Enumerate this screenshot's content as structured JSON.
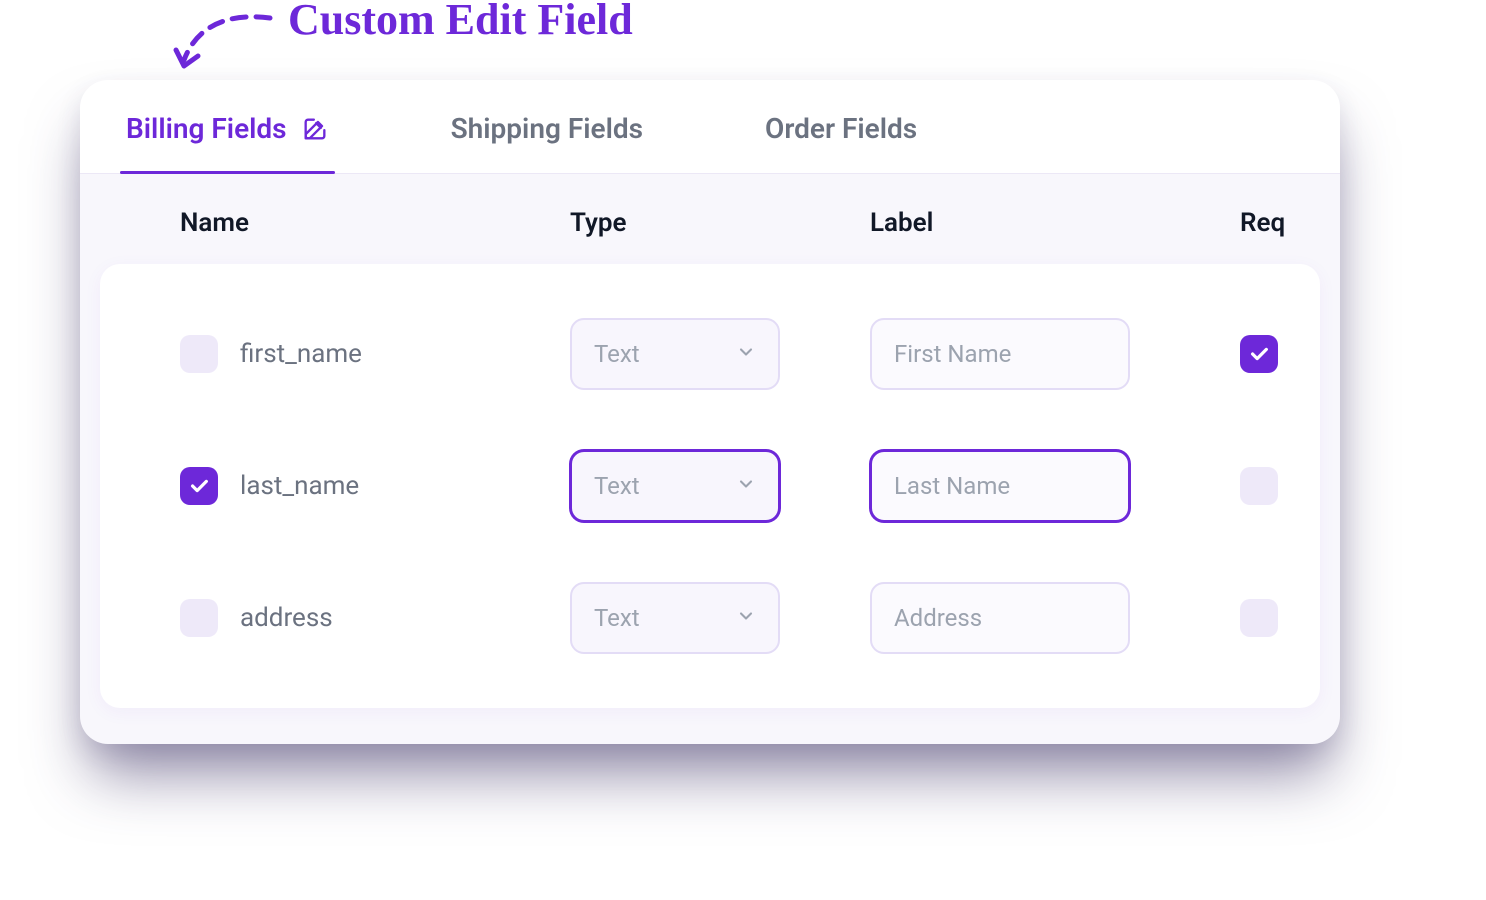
{
  "annotation": {
    "text": "Custom Edit Field"
  },
  "tabs": [
    {
      "id": "billing",
      "label": "Billing Fields",
      "active": true,
      "has_edit_icon": true
    },
    {
      "id": "shipping",
      "label": "Shipping Fields",
      "active": false,
      "has_edit_icon": false
    },
    {
      "id": "order",
      "label": "Order Fields",
      "active": false,
      "has_edit_icon": false
    }
  ],
  "columns": {
    "name": "Name",
    "type": "Type",
    "label": "Label",
    "req": "Req"
  },
  "type_options": [
    "Text"
  ],
  "rows": [
    {
      "selected": false,
      "name": "first_name",
      "type": "Text",
      "label_placeholder": "First Name",
      "required": true,
      "focused": false
    },
    {
      "selected": true,
      "name": "last_name",
      "type": "Text",
      "label_placeholder": "Last Name",
      "required": false,
      "focused": true
    },
    {
      "selected": false,
      "name": "address",
      "type": "Text",
      "label_placeholder": "Address",
      "required": false,
      "focused": false
    }
  ],
  "colors": {
    "accent": "#6D28D9",
    "muted_bg": "#F8F7FC",
    "checkbox_unchecked": "#EEE9F9",
    "text_muted": "#6B7280"
  }
}
